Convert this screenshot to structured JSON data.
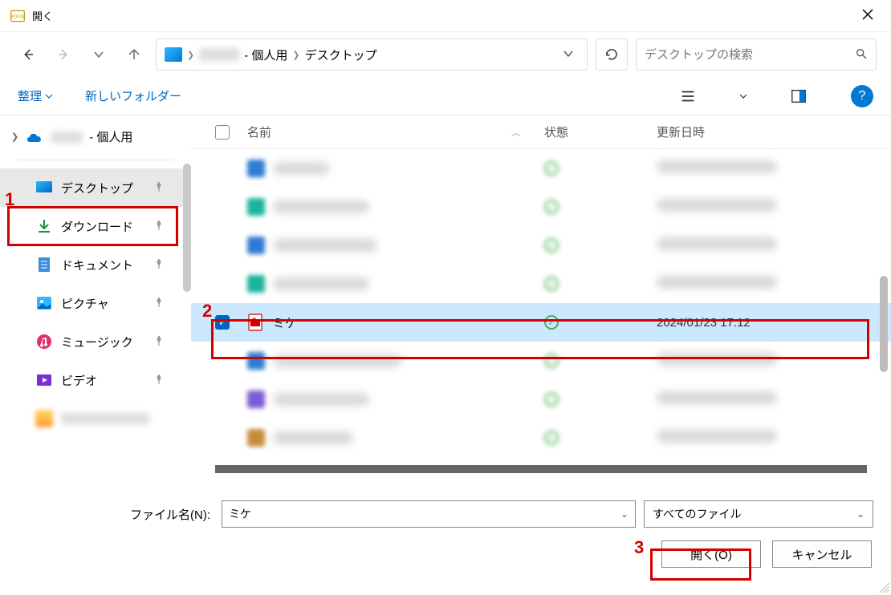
{
  "window": {
    "title": "開く"
  },
  "breadcrumb": {
    "personal_suffix": " - 個人用",
    "desktop": "デスクトップ"
  },
  "search": {
    "placeholder": "デスクトップの検索"
  },
  "toolbar": {
    "organize": "整理",
    "new_folder": "新しいフォルダー"
  },
  "sidebar": {
    "top_suffix": " - 個人用",
    "items": [
      {
        "label": "デスクトップ",
        "selected": true
      },
      {
        "label": "ダウンロード"
      },
      {
        "label": "ドキュメント"
      },
      {
        "label": "ピクチャ"
      },
      {
        "label": "ミュージック"
      },
      {
        "label": "ビデオ"
      }
    ]
  },
  "columns": {
    "name": "名前",
    "status": "状態",
    "modified": "更新日時"
  },
  "files": {
    "selected": {
      "name": "ミケ",
      "modified": "2024/01/23 17:12"
    },
    "blurred_rows": [
      {
        "icon_color": "#2f7bd4",
        "name_w": 70,
        "date_w": 150
      },
      {
        "icon_color": "#1db39b",
        "name_w": 120,
        "date_w": 150
      },
      {
        "icon_color": "#2f7bd4",
        "name_w": 130,
        "date_w": 150
      },
      {
        "icon_color": "#1db39b",
        "name_w": 120,
        "date_w": 150
      }
    ],
    "blurred_rows_after": [
      {
        "icon_color": "#2f7bd4",
        "name_w": 160,
        "date_w": 150
      },
      {
        "icon_color": "#7a5bd4",
        "name_w": 120,
        "date_w": 150
      },
      {
        "icon_color": "#c58b3b",
        "name_w": 100,
        "date_w": 150
      }
    ]
  },
  "footer": {
    "filename_label": "ファイル名(N):",
    "filename_value": "ミケ",
    "filter": "すべてのファイル",
    "open": "開く(O)",
    "cancel": "キャンセル"
  },
  "annotations": {
    "one": "1",
    "two": "2",
    "three": "3"
  }
}
